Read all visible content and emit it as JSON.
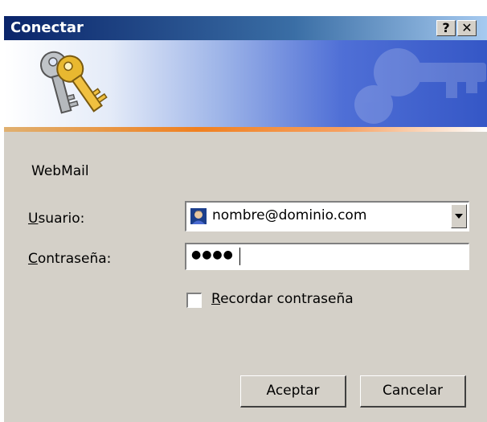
{
  "window": {
    "title": "Conectar",
    "help_button": "?",
    "close_button": "✕"
  },
  "dialog": {
    "site_label": "WebMail",
    "user": {
      "label_accesskey": "U",
      "label_rest": "suario:",
      "value": "nombre@dominio.com"
    },
    "password": {
      "label_accesskey": "C",
      "label_rest": "ontraseña:",
      "masked_value": "●●●●"
    },
    "remember": {
      "label_accesskey": "R",
      "label_rest": "ecordar contraseña",
      "checked": false
    },
    "buttons": {
      "ok": "Aceptar",
      "cancel": "Cancelar"
    }
  },
  "icons": [
    "keys-icon",
    "user-account-icon",
    "dropdown-arrow-icon"
  ],
  "colors": {
    "title_bar": "#0a246a",
    "dialog_bg": "#d4d0c8",
    "accent_line": "#f08020"
  }
}
